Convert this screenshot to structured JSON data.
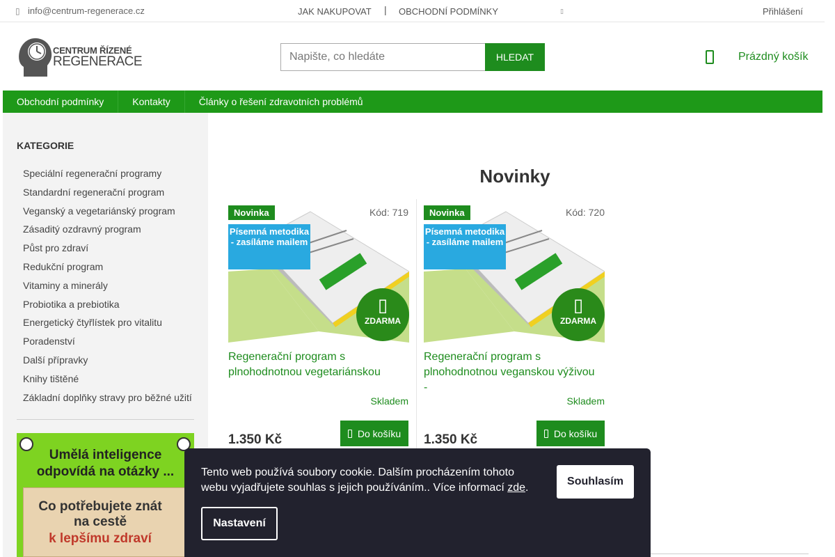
{
  "topbar": {
    "email": "info@centrum-regenerace.cz",
    "links": [
      "JAK NAKUPOVAT",
      "OBCHODNÍ PODMÍNKY"
    ],
    "separator": "|",
    "login": "Přihlášení"
  },
  "logo": {
    "line1": "CENTRUM ŘÍZENÉ",
    "line2": "REGENERACE"
  },
  "search": {
    "placeholder": "Napište, co hledáte",
    "button": "HLEDAT"
  },
  "cart": {
    "label": "Prázdný košík"
  },
  "nav": [
    "Obchodní podmínky",
    "Kontakty",
    "Články o řešení zdravotních problémů"
  ],
  "sidebar": {
    "title": "KATEGORIE",
    "items": [
      "Speciální regenerační programy",
      "Standardní regenerační program",
      "Veganský a vegetariánský program",
      "Zásaditý ozdravný program",
      "Půst pro zdraví",
      "Redukční program",
      "Vitaminy a minerály",
      "Probiotika a prebiotika",
      "Energetický čtyřlístek pro vitalitu",
      "Poradenství",
      "Další přípravky",
      "Knihy tištěné",
      "Základní doplňky stravy pro běžné užití"
    ],
    "banner": {
      "line1": "Umělá inteligence",
      "line2": "odpovídá na otázky ...",
      "card_line1": "Co potřebujete znát",
      "card_line2": "na cestě",
      "card_line3": "k lepšímu zdraví"
    }
  },
  "main": {
    "title": "Novinky",
    "products": [
      {
        "badge_new": "Novinka",
        "code": "Kód: 719",
        "method": "Písemná metodika - zasíláme mailem",
        "free": "ZDARMA",
        "name": "Regenerační program s plnohodnotnou vegetariánskou",
        "stock": "Skladem",
        "price": "1.350 Kč",
        "buy": "Do košíku"
      },
      {
        "badge_new": "Novinka",
        "code": "Kód: 720",
        "method": "Písemná metodika - zasíláme mailem",
        "free": "ZDARMA",
        "name": "Regenerační program s plnohodnotnou veganskou výživou -",
        "stock": "Skladem",
        "price": "1.350 Kč",
        "buy": "Do košíku"
      }
    ]
  },
  "cookie": {
    "message": "Tento web používá soubory cookie. Dalším procházením tohoto webu vyjadřujete souhlas s jejich používáním.. Více informací",
    "link": "zde",
    "accept": "Souhlasím",
    "settings": "Nastavení"
  },
  "colors": {
    "brand_green": "#1e8c1e",
    "nav_green": "#1e9918",
    "badge_blue": "#29a9e0",
    "cookie_bg": "#22222e"
  },
  "icons": [
    "mail-icon",
    "cart-icon",
    "gift-icon"
  ]
}
